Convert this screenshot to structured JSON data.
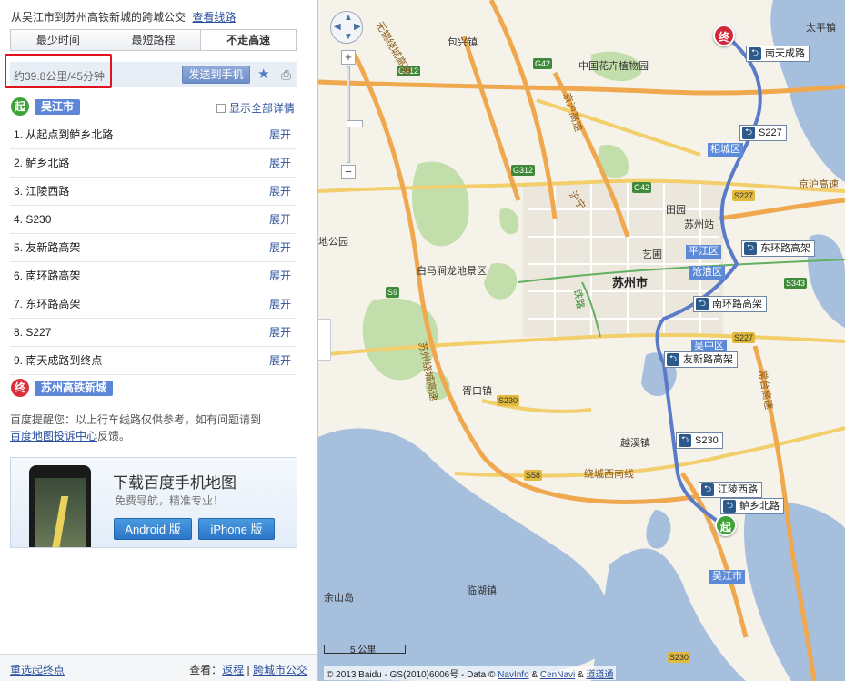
{
  "route": {
    "title": "从吴江市到苏州高铁新城的跨城公交",
    "view_route_link": "查看线路",
    "tabs": [
      "最少时间",
      "最短路程",
      "不走高速"
    ],
    "summary": "约39.8公里/45分钟",
    "send_label": "发送到手机",
    "start_badge": "起",
    "start_name": "吴江市",
    "show_all": "显示全部详情",
    "end_badge": "终",
    "end_name": "苏州高铁新城",
    "expand_label": "展开",
    "steps": [
      "1. 从起点到鲈乡北路",
      "2. 鲈乡北路",
      "3. 江陵西路",
      "4. S230",
      "5. 友新路高架",
      "6. 南环路高架",
      "7. 东环路高架",
      "8. S227",
      "9. 南天成路到终点"
    ],
    "tip_text": "百度提醒您：以上行车线路仅供参考，如有问题请到",
    "tip_link": "百度地图投诉中心",
    "tip_suffix": "反馈。"
  },
  "ad": {
    "title": "下载百度手机地图",
    "subtitle": "免费导航，精准专业！",
    "android": "Android 版",
    "iphone": "iPhone 版"
  },
  "footer": {
    "reselect": "重选起终点",
    "view_label": "查看：",
    "return_link": "返程",
    "crosscity_link": "跨城市公交"
  },
  "map": {
    "place_labels": [
      "包兴镇",
      "中国花卉植物园",
      "田园",
      "苏州站",
      "艺圃",
      "平江区",
      "沧浪区",
      "苏州市",
      "白马涧龙池景区",
      "相城区",
      "吴中区",
      "胥口镇",
      "越溪镇",
      "临湖镇",
      "吴江市",
      "余山岛",
      "地公园",
      "太平镇"
    ],
    "highway_labels": [
      "G312",
      "G42",
      "G312",
      "G42",
      "S9",
      "S230",
      "S227",
      "S58",
      "S230",
      "S227",
      "S343"
    ],
    "road_labels": [
      "无锡绕城高速",
      "京沪高速",
      "苏州绕城高速",
      "绕城西南线",
      "常台高速",
      "京沪高速",
      "沪宁",
      "铁路"
    ],
    "route_tags": [
      "南天成路",
      "S227",
      "东环路高架",
      "南环路高架",
      "友新路高架",
      "S230",
      "江陵西路",
      "鲈乡北路"
    ],
    "end_badge": "终",
    "start_badge": "起",
    "scale": "5 公里",
    "copyright": "© 2013 Baidu - GS(2010)6006号 - Data ©",
    "copy_links": [
      "NavInfo",
      "CenNavi",
      "道道通"
    ],
    "copy_amp": "&"
  },
  "colors": {
    "route_line": "#5b7bc8",
    "highlight": "#e0141e",
    "link": "#2a4f9c",
    "water": "#a5bfdd",
    "park": "#c2deaa"
  }
}
